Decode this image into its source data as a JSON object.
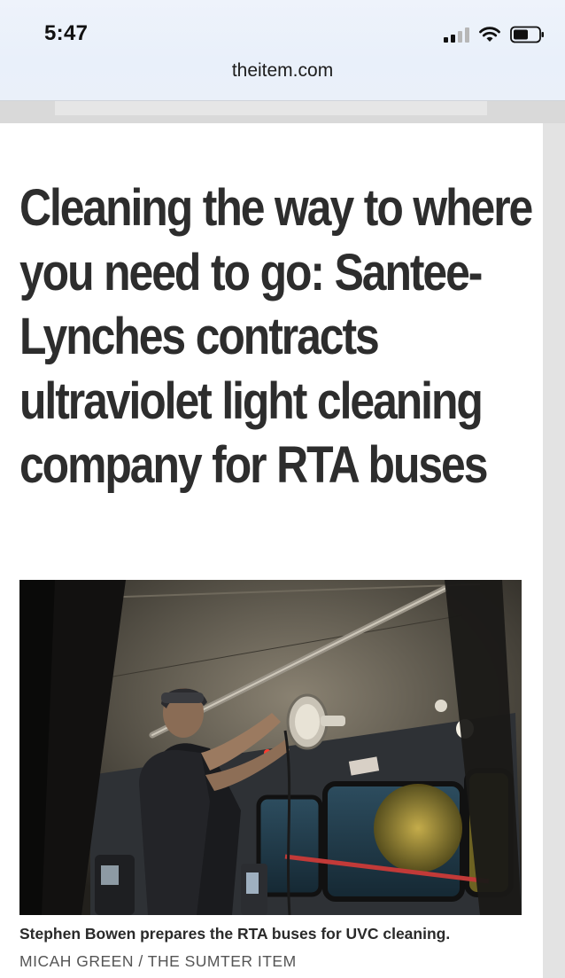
{
  "status_bar": {
    "time": "5:47"
  },
  "browser": {
    "url": "theitem.com"
  },
  "article": {
    "headline": "Cleaning the way to where you need to go: Santee-Lynches contracts ultraviolet light cleaning company for RTA buses",
    "photo": {
      "caption": "Stephen Bowen prepares the RTA buses for UVC cleaning.",
      "credit": "MICAH GREEN / THE SUMTER ITEM"
    }
  }
}
